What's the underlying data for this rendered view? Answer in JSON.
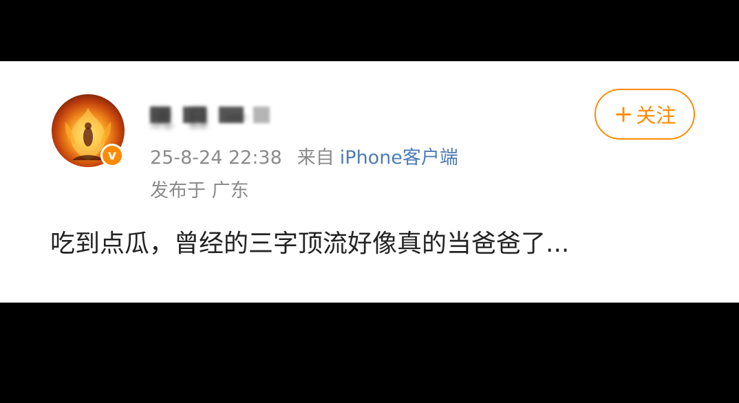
{
  "post": {
    "username": "洸 日 一",
    "timestamp": "25-8-24 22:38",
    "source_prefix": "来自",
    "source_device": "iPhone客户端",
    "location": "发布于 广东",
    "follow_label": "关注",
    "follow_plus": "+",
    "verified_mark": "v",
    "content": "吃到点瓜，曾经的三字顶流好像真的当爸爸了..."
  },
  "colors": {
    "accent": "#ff8a00",
    "link": "#4e7bb6",
    "meta_text": "#8a8a8a",
    "body_text": "#222222"
  },
  "icons": {
    "avatar": "flame-avatar-image",
    "verified": "verified-v-badge-icon"
  }
}
